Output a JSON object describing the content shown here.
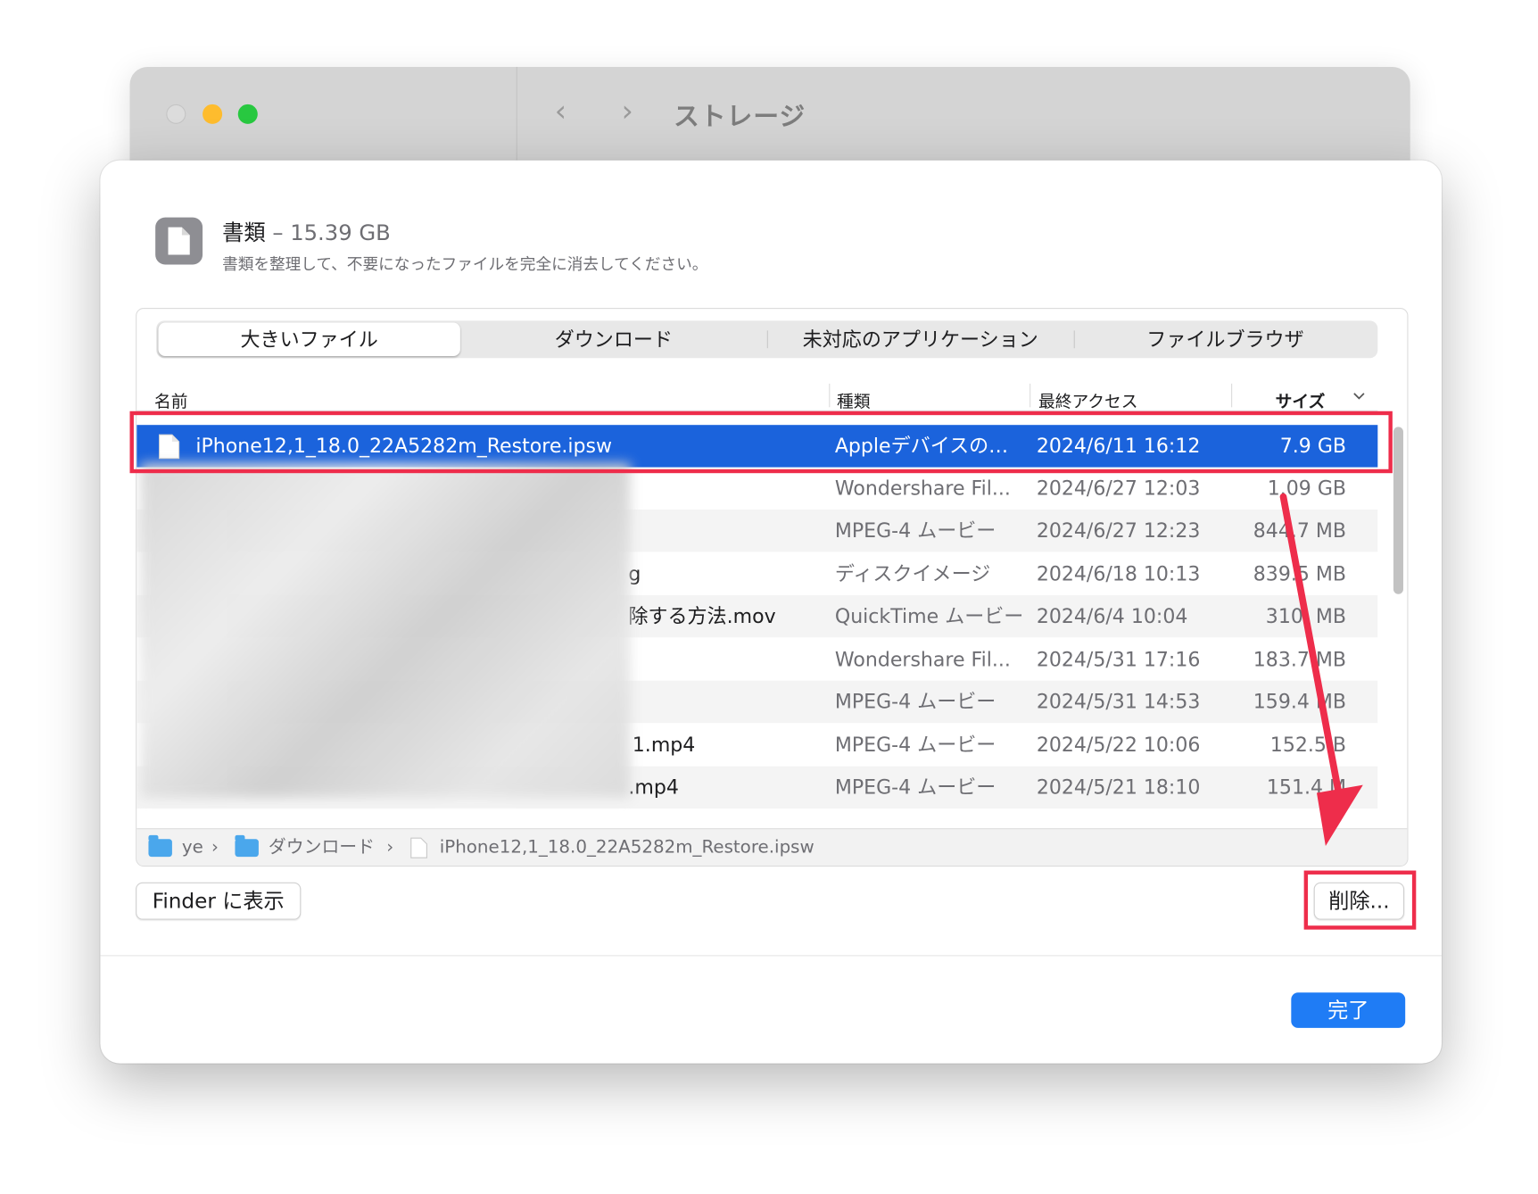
{
  "background_window": {
    "title": "ストレージ",
    "back_glyph": "‹",
    "forward_glyph": "›"
  },
  "header": {
    "category": "書類",
    "separator": " – ",
    "size": "15.39 GB",
    "description": "書類を整理して、不要になったファイルを完全に消去してください。"
  },
  "tabs": [
    "大きいファイル",
    "ダウンロード",
    "未対応のアプリケーション",
    "ファイルブラウザ"
  ],
  "columns": {
    "name": "名前",
    "kind": "種類",
    "last_access": "最終アクセス",
    "size": "サイズ"
  },
  "rows": [
    {
      "name": "iPhone12,1_18.0_22A5282m_Restore.ipsw",
      "kind": "Appleデバイスの…",
      "date": "2024/6/11 16:12",
      "size": "7.9 GB"
    },
    {
      "name": "",
      "kind": "Wondershare Fil...",
      "date": "2024/6/27 12:03",
      "size": "1.09 GB"
    },
    {
      "name": "",
      "kind": "MPEG-4 ムービー",
      "date": "2024/6/27 12:23",
      "size": "844.7 MB"
    },
    {
      "name": "g",
      "kind": "ディスクイメージ",
      "date": "2024/6/18 10:13",
      "size": "839.5 MB"
    },
    {
      "name": "除する方法.mov",
      "kind": "QuickTime ムービー",
      "date": "2024/6/4 10:04",
      "size": "310.  MB"
    },
    {
      "name": "",
      "kind": "Wondershare Fil...",
      "date": "2024/5/31 17:16",
      "size": "183.7 MB"
    },
    {
      "name": "",
      "kind": "MPEG-4 ムービー",
      "date": "2024/5/31 14:53",
      "size": "159.4  MB"
    },
    {
      "name": "1.mp4",
      "kind": "MPEG-4 ムービー",
      "date": "2024/5/22 10:06",
      "size": "152.5  B"
    },
    {
      "name": ".mp4",
      "kind": "MPEG-4 ムービー",
      "date": "2024/5/21 18:10",
      "size": "151.4 M"
    }
  ],
  "pathbar": {
    "home": "ye",
    "downloads": "ダウンロード",
    "file": "iPhone12,1_18.0_22A5282m_Restore.ipsw",
    "chev": "›"
  },
  "buttons": {
    "show_in_finder": "Finder に表示",
    "delete": "削除...",
    "done": "完了"
  },
  "colors": {
    "selection": "#1b63dc",
    "annotation": "#ee2d4b",
    "primary_button": "#1f7cf5"
  }
}
